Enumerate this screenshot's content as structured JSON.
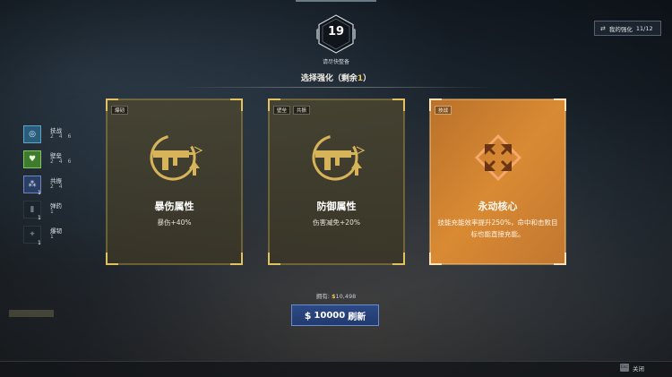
{
  "timer": {
    "value": "19",
    "subtitle": "请尽快整备"
  },
  "my_upgrades": {
    "label": "我的强化",
    "count": "11/12"
  },
  "choose": {
    "prefix": "选择强化（剩余",
    "remaining": "1",
    "suffix": "）"
  },
  "sidebar": {
    "items": [
      {
        "name": "技战",
        "levels": "2 4 6",
        "badge": "",
        "style": "tech"
      },
      {
        "name": "壁垒",
        "levels": "2 4 6",
        "badge": "",
        "style": "fort"
      },
      {
        "name": "共振",
        "levels": "2 4",
        "badge": "1",
        "style": "res"
      },
      {
        "name": "弹药",
        "levels": "1",
        "badge": "1",
        "style": "dim"
      },
      {
        "name": "爆韧",
        "levels": "1",
        "badge": "1",
        "style": "dim"
      }
    ]
  },
  "cards": [
    {
      "tags": [
        "爆韧"
      ],
      "name": "暴伤属性",
      "desc": "暴伤+40%",
      "style": "gold",
      "emblem": "gun-upgrade"
    },
    {
      "tags": [
        "壁垒",
        "共振"
      ],
      "name": "防御属性",
      "desc": "伤害减免+20%",
      "style": "gold",
      "emblem": "gun-upgrade"
    },
    {
      "tags": [
        "技战"
      ],
      "name": "永动核心",
      "desc": "技能充能效率提升250%，命中和击败目标也能直接充能。",
      "style": "orange",
      "emblem": "core-arrows"
    }
  ],
  "money": {
    "owned_label": "拥有:",
    "owned_value": "10,498"
  },
  "refresh": {
    "currency": "$",
    "cost": "10000",
    "label": "刷新"
  },
  "footer": {
    "close_key": "Esc",
    "close_label": "关闭"
  },
  "colors": {
    "gold": "#c9a84a",
    "orange": "#e79a2f",
    "refresh_blue": "#2d4a86"
  }
}
